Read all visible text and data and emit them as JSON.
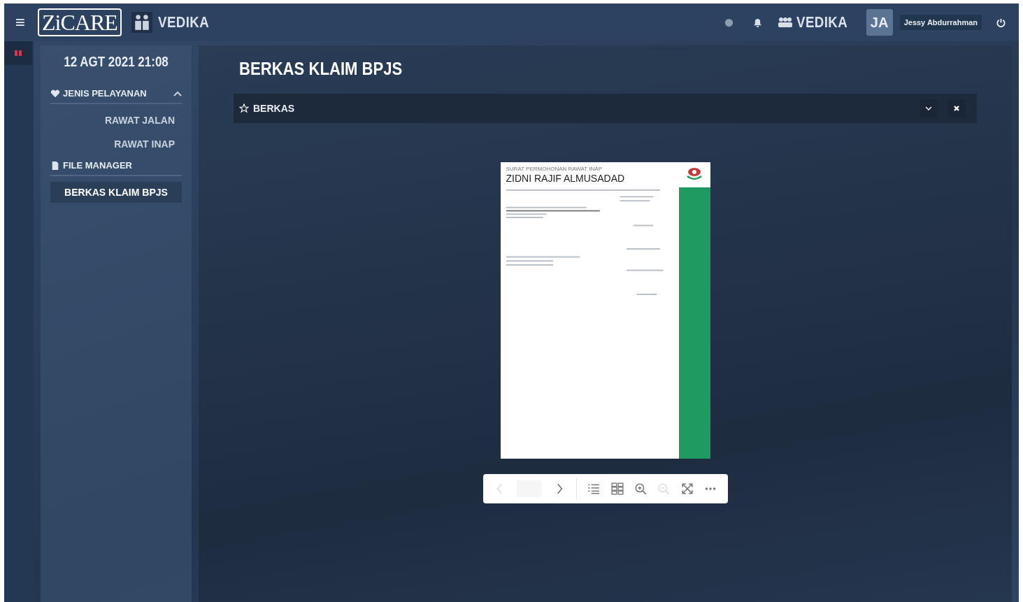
{
  "topbar": {
    "menu_icon": "≡",
    "logo": "ZiCARE",
    "app_name": "VEDIKA",
    "role": "VEDIKA",
    "avatar_initials": "JA",
    "user_name": "Jessy Abdurrahman"
  },
  "sidebar": {
    "datetime": "12 AGT 2021 21:08",
    "sections": [
      {
        "label": "JENIS PELAYANAN",
        "kind": "heart",
        "expanded": true,
        "items": [
          {
            "label": "RAWAT JALAN",
            "selected": false
          },
          {
            "label": "RAWAT INAP",
            "selected": false
          }
        ]
      },
      {
        "label": "FILE MANAGER",
        "kind": "file",
        "expanded": true,
        "items": [
          {
            "label": "BERKAS KLAIM BPJS",
            "selected": true
          }
        ]
      }
    ]
  },
  "page": {
    "title": "BERKAS KLAIM BPJS",
    "panel": {
      "title": "BERKAS",
      "collapsed": false
    }
  },
  "document": {
    "header": "SURAT PERMOHONAN RAWAT INAP",
    "patient_name": "ZIDNI RAJIF ALMUSADAD"
  },
  "viewer_toolbar": [
    {
      "kind": "prev",
      "disabled": true
    },
    {
      "kind": "page",
      "disabled": false
    },
    {
      "kind": "next",
      "disabled": false
    },
    {
      "kind": "outline",
      "disabled": false
    },
    {
      "kind": "thumbnails",
      "disabled": false
    },
    {
      "kind": "zoom-in",
      "disabled": false
    },
    {
      "kind": "zoom-out",
      "disabled": true
    },
    {
      "kind": "fullscreen",
      "disabled": false
    },
    {
      "kind": "more",
      "disabled": false
    }
  ]
}
